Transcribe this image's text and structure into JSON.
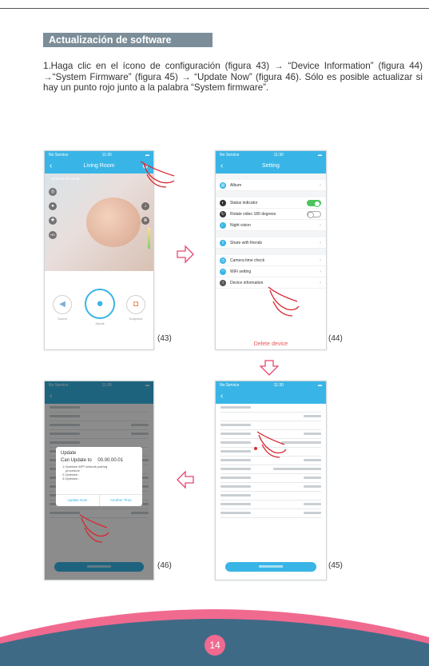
{
  "section": {
    "heading": "Actualización de software",
    "paragraph": "1.Haga clic en el ícono de configuración (figura 43) → “Device Information” (figura 44) →“System Firmware” (figura 45) → “Update Now” (figura 46). Sólo es posible actualizar si hay un punto rojo junto a la palabra “System firmware”."
  },
  "status": {
    "carrier": "No Service",
    "time": "11:30",
    "battery": "▬"
  },
  "fig43": {
    "label": "(43)",
    "title": "Living Room",
    "timestamp": "2019-06-20 15:46",
    "controls": {
      "sound": "Sound",
      "speak": "Speak",
      "snapshot": "Snapshot"
    }
  },
  "fig44": {
    "label": "(44)",
    "title": "Setting",
    "items": [
      {
        "label": "Album"
      },
      {
        "label": "Status indicator"
      },
      {
        "label": "Rotate video 180 degrees"
      },
      {
        "label": "Night vision"
      },
      {
        "label": "Share with friends"
      },
      {
        "label": "Camera time check"
      },
      {
        "label": "WiFi setting"
      },
      {
        "label": "Device information"
      }
    ],
    "delete": "Delete device"
  },
  "fig45": {
    "label": "(45)"
  },
  "fig46": {
    "label": "(46)",
    "dialog": {
      "title": "Update",
      "can_update": "Can Update to",
      "version": "00.00.00.01",
      "notes": [
        "1.Optimize APP network pairing",
        "procedure",
        "2.Optimize...",
        "3.Optimize..."
      ],
      "update_now": "Update Now",
      "another_time": "Another Time"
    }
  },
  "page_number": "14",
  "colors": {
    "accent": "#38b5e6",
    "heading_bg": "#7b8d98",
    "arrow": "#e8466e",
    "wave_dark": "#3f6a86",
    "wave_pink": "#f06a8f"
  }
}
